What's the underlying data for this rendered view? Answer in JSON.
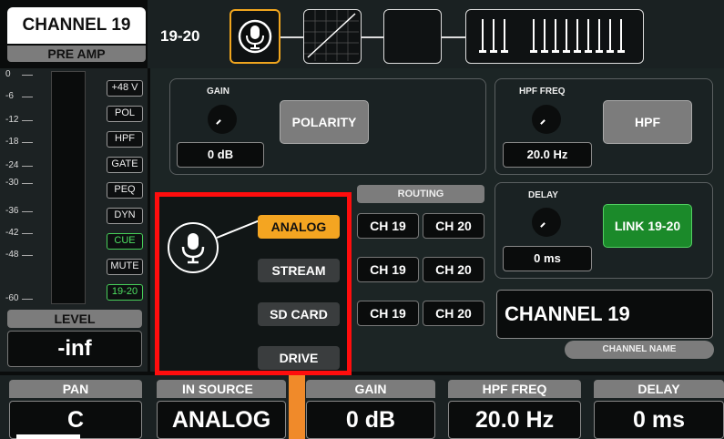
{
  "header": {
    "channel_title": "CHANNEL 19",
    "preamp_tab": "PRE AMP",
    "pair_label": "19-20",
    "nav": [
      {
        "name": "mic-icon"
      },
      {
        "name": "hpf-curve"
      },
      {
        "name": "dynamics"
      },
      {
        "name": "eq-faders"
      }
    ]
  },
  "meter": {
    "scale": [
      "0",
      "-6",
      "-12",
      "-18",
      "-24",
      "-30",
      "-36",
      "-42",
      "-48",
      "-60"
    ],
    "side_buttons": [
      "+48 V",
      "POL",
      "HPF",
      "GATE",
      "PEQ",
      "DYN",
      "CUE",
      "MUTE",
      "19-20"
    ],
    "level_label": "LEVEL",
    "level_value": "-inf"
  },
  "gain_group": {
    "label": "GAIN",
    "value": "0 dB",
    "polarity_label": "POLARITY"
  },
  "hpf_group": {
    "label": "HPF FREQ",
    "value": "20.0 Hz",
    "hpf_label": "HPF"
  },
  "delay_group": {
    "label": "DELAY",
    "value": "0 ms",
    "link_label": "LINK 19-20"
  },
  "source": {
    "options": [
      "ANALOG",
      "STREAM",
      "SD CARD",
      "DRIVE"
    ],
    "selected": "ANALOG"
  },
  "routing": {
    "label": "ROUTING",
    "rows": [
      [
        "CH 19",
        "CH 20"
      ],
      [
        "CH 19",
        "CH 20"
      ],
      [
        "CH 19",
        "CH 20"
      ]
    ]
  },
  "channel_name": {
    "value": "CHANNEL 19",
    "label": "CHANNEL NAME"
  },
  "bottom": {
    "pan_label": "PAN",
    "pan_value": "C",
    "in_source_label": "IN SOURCE",
    "in_source_value": "ANALOG",
    "gain_label": "GAIN",
    "gain_value": "0 dB",
    "hpf_label": "HPF FREQ",
    "hpf_value": "20.0 Hz",
    "delay_label": "DELAY",
    "delay_value": "0 ms"
  },
  "colors": {
    "accent": "#f4a521",
    "active_green": "#1b8a2a",
    "highlight_frame": "#ff0d0d"
  }
}
